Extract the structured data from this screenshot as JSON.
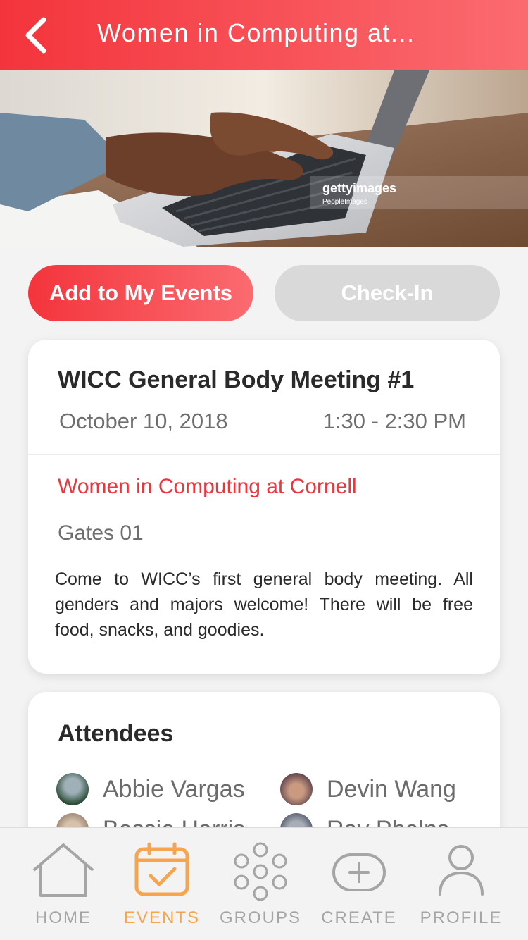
{
  "header": {
    "title": "Women in Computing at..."
  },
  "hero": {
    "watermark_brand": "gettyimages",
    "watermark_sub": "PeopleImages"
  },
  "actions": {
    "add_label": "Add to My Events",
    "checkin_label": "Check-In"
  },
  "event": {
    "title": "WICC General Body Meeting #1",
    "date": "October 10, 2018",
    "time": "1:30 - 2:30 PM",
    "organization": "Women in Computing at Cornell",
    "location": "Gates 01",
    "description": "Come to WICC’s first general body meeting. All genders and majors welcome! There will be free food, snacks, and goodies."
  },
  "attendees": {
    "title": "Attendees",
    "list": [
      {
        "name": "Abbie Vargas"
      },
      {
        "name": "Devin Wang"
      },
      {
        "name": "Bessie Harris"
      },
      {
        "name": "Ray Phelps"
      }
    ]
  },
  "tabbar": {
    "tabs": [
      {
        "label": "HOME",
        "icon": "home-icon"
      },
      {
        "label": "EVENTS",
        "icon": "calendar-icon"
      },
      {
        "label": "GROUPS",
        "icon": "groups-icon"
      },
      {
        "label": "CREATE",
        "icon": "plus-circle-icon"
      },
      {
        "label": "PROFILE",
        "icon": "profile-icon"
      }
    ],
    "active": "EVENTS"
  },
  "colors": {
    "accent_red": "#f4343c",
    "accent_orange": "#f6a44d",
    "inactive_gray": "#a5a5a5"
  }
}
